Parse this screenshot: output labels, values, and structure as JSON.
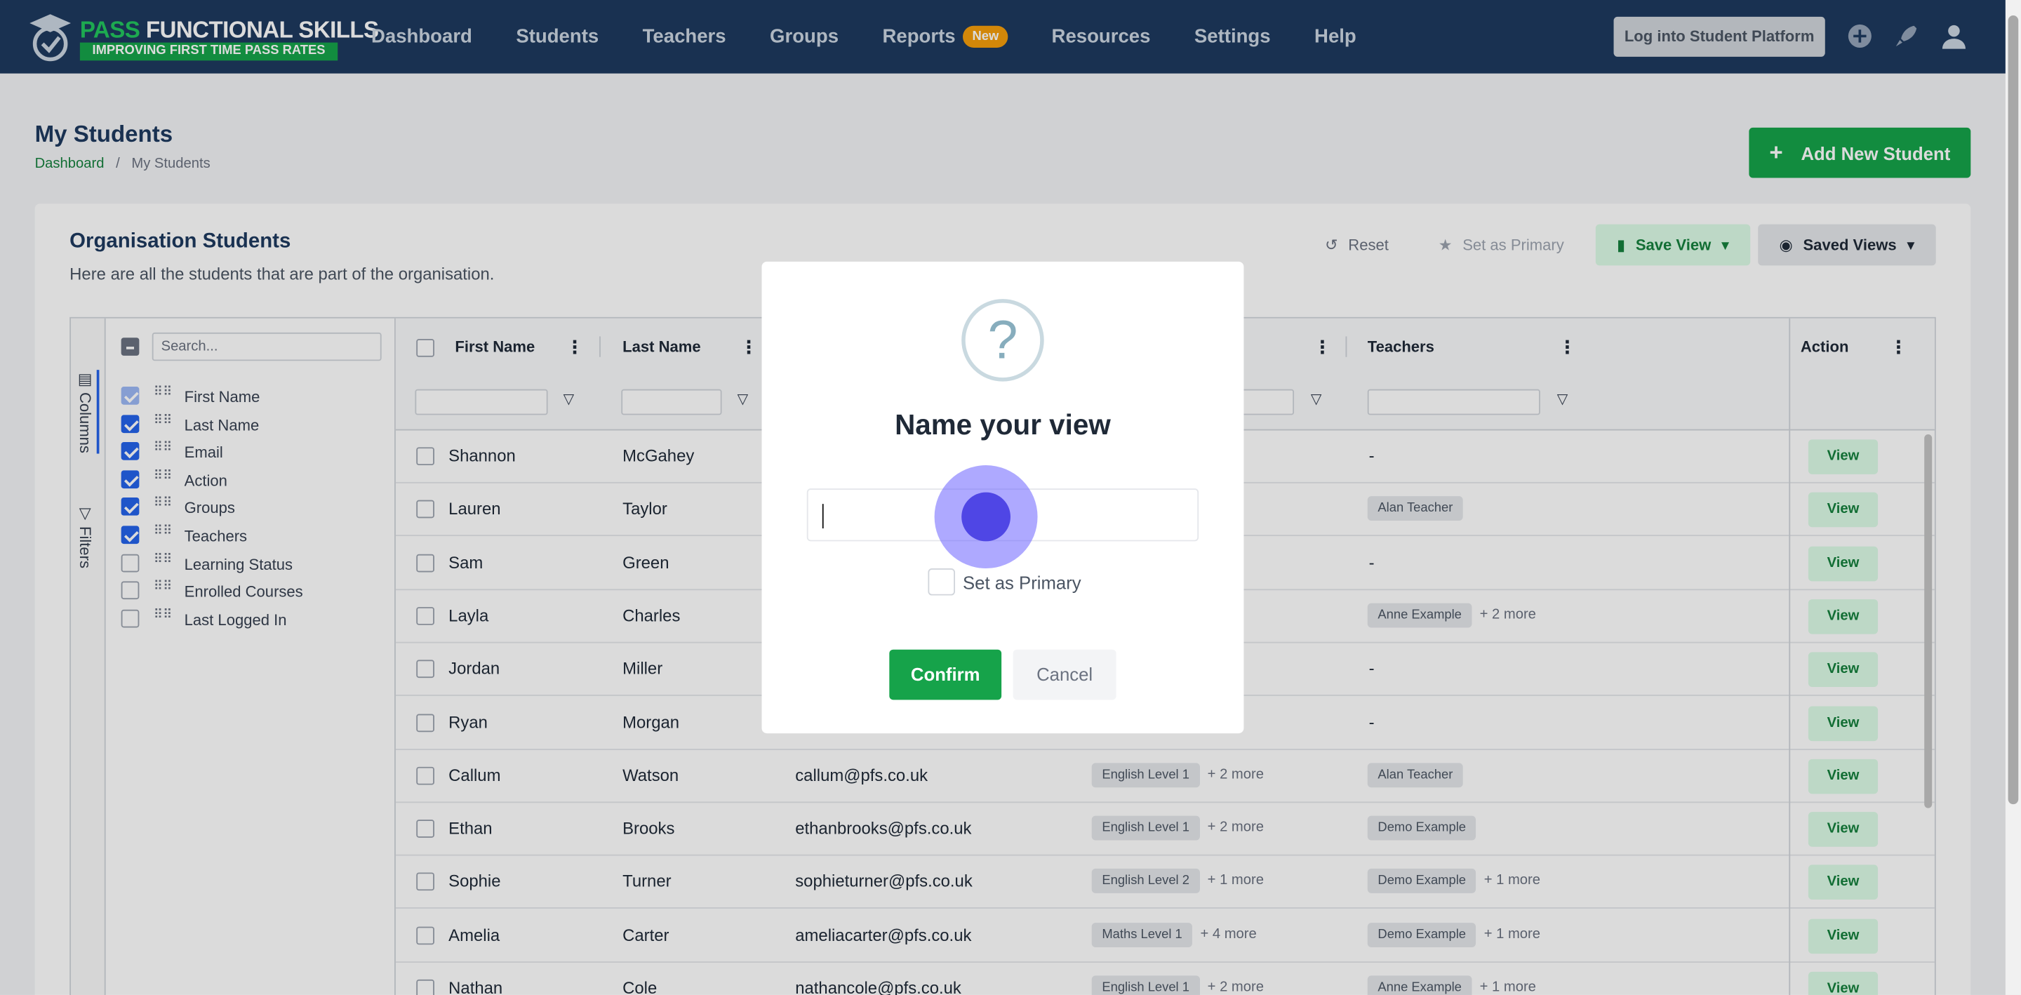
{
  "brand": {
    "title_a": "PASS",
    "title_b": " FUNCTIONAL SKILLS",
    "tagline": "IMPROVING FIRST TIME PASS RATES"
  },
  "nav": {
    "items": [
      "Dashboard",
      "Students",
      "Teachers",
      "Groups",
      "Reports",
      "Resources",
      "Settings",
      "Help"
    ],
    "reports_badge": "New",
    "login_button": "Log into Student Platform"
  },
  "page": {
    "title": "My Students",
    "breadcrumb": [
      "Dashboard",
      "/",
      "My Students"
    ],
    "add_button": "Add New Student"
  },
  "card": {
    "title": "Organisation Students",
    "subtitle": "Here are all the students that are part of the organisation.",
    "toolbar": {
      "reset": "Reset",
      "set_primary": "Set as Primary",
      "save_view": "Save View",
      "saved_views": "Saved Views"
    }
  },
  "grid": {
    "side_tabs": [
      "Columns",
      "Filters"
    ],
    "search_placeholder": "Search...",
    "columns_panel": [
      {
        "label": "First Name",
        "checked": true,
        "locked": true
      },
      {
        "label": "Last Name",
        "checked": true
      },
      {
        "label": "Email",
        "checked": true
      },
      {
        "label": "Action",
        "checked": true
      },
      {
        "label": "Groups",
        "checked": true
      },
      {
        "label": "Teachers",
        "checked": true
      },
      {
        "label": "Learning Status",
        "checked": false
      },
      {
        "label": "Enrolled Courses",
        "checked": false
      },
      {
        "label": "Last Logged In",
        "checked": false
      }
    ],
    "headers": {
      "first": "First Name",
      "last": "Last Name",
      "teachers": "Teachers",
      "action": "Action"
    },
    "view_label": "View",
    "rows": [
      {
        "first": "Shannon",
        "last": "McGahey",
        "email": "",
        "group": "",
        "group_more": "",
        "teacher": "-",
        "teacher_more": ""
      },
      {
        "first": "Lauren",
        "last": "Taylor",
        "email": "",
        "group": "",
        "group_more": "",
        "teacher": "Alan Teacher",
        "teacher_more": ""
      },
      {
        "first": "Sam",
        "last": "Green",
        "email": "",
        "group": "",
        "group_more": "",
        "teacher": "-",
        "teacher_more": ""
      },
      {
        "first": "Layla",
        "last": "Charles",
        "email": "",
        "group": "",
        "group_more": "",
        "teacher": "Anne Example",
        "teacher_more": "+ 2 more"
      },
      {
        "first": "Jordan",
        "last": "Miller",
        "email": "",
        "group": "",
        "group_more": "",
        "teacher": "-",
        "teacher_more": ""
      },
      {
        "first": "Ryan",
        "last": "Morgan",
        "email": "",
        "group": "",
        "group_more": "",
        "teacher": "-",
        "teacher_more": ""
      },
      {
        "first": "Callum",
        "last": "Watson",
        "email": "callum@pfs.co.uk",
        "group": "English Level 1",
        "group_more": "+ 2 more",
        "teacher": "Alan Teacher",
        "teacher_more": ""
      },
      {
        "first": "Ethan",
        "last": "Brooks",
        "email": "ethanbrooks@pfs.co.uk",
        "group": "English Level 1",
        "group_more": "+ 2 more",
        "teacher": "Demo Example",
        "teacher_more": ""
      },
      {
        "first": "Sophie",
        "last": "Turner",
        "email": "sophieturner@pfs.co.uk",
        "group": "English Level 2",
        "group_more": "+ 1 more",
        "teacher": "Demo Example",
        "teacher_more": "+ 1 more"
      },
      {
        "first": "Amelia",
        "last": "Carter",
        "email": "ameliacarter@pfs.co.uk",
        "group": "Maths Level 1",
        "group_more": "+ 4 more",
        "teacher": "Demo Example",
        "teacher_more": "+ 1 more"
      },
      {
        "first": "Nathan",
        "last": "Cole",
        "email": "nathancole@pfs.co.uk",
        "group": "English Level 1",
        "group_more": "+ 2 more",
        "teacher": "Anne Example",
        "teacher_more": "+ 1 more"
      }
    ]
  },
  "modal": {
    "icon": "?",
    "title": "Name your view",
    "input_value": "",
    "set_primary_label": "Set as Primary",
    "confirm": "Confirm",
    "cancel": "Cancel"
  },
  "colors": {
    "nav_bg": "#1e3a5f",
    "brand_green": "#16a34a",
    "accent_blue": "#2563eb",
    "ripple": "#4f46e5"
  }
}
